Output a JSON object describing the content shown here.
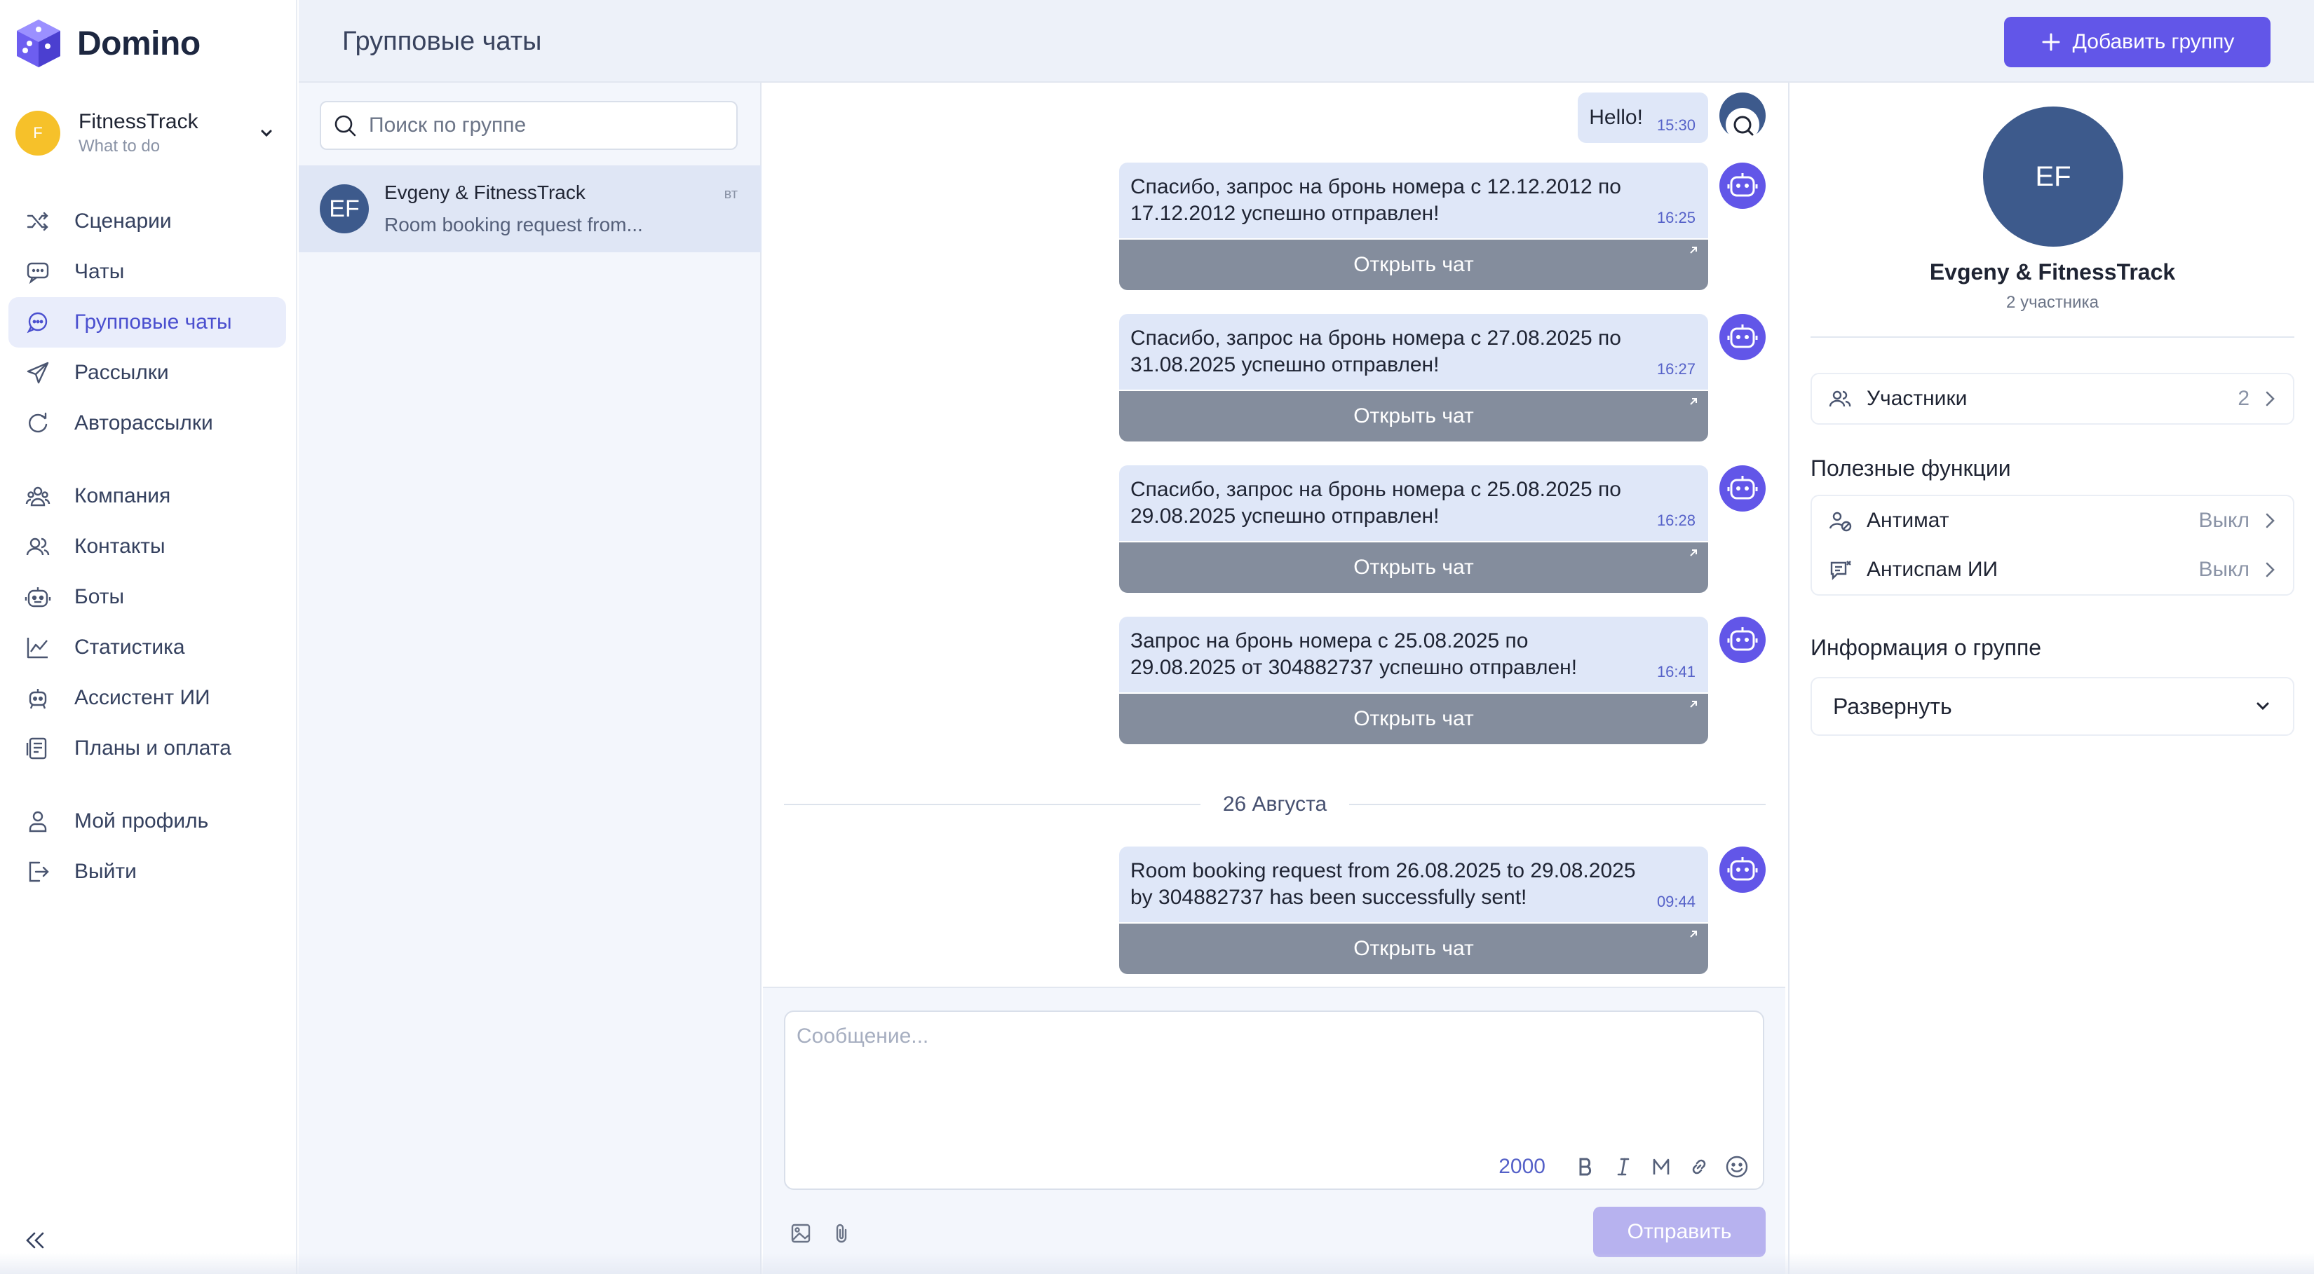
{
  "app": {
    "name": "Domino"
  },
  "company": {
    "initial": "F",
    "name": "FitnessTrack",
    "subtitle": "What to do"
  },
  "sidebar": {
    "items": [
      {
        "label": "Сценарии",
        "icon": "shuffle-icon"
      },
      {
        "label": "Чаты",
        "icon": "chat-bubble-icon"
      },
      {
        "label": "Групповые чаты",
        "icon": "group-chat-icon",
        "active": true
      },
      {
        "label": "Рассылки",
        "icon": "send-icon"
      },
      {
        "label": "Авторассылки",
        "icon": "auto-send-icon"
      },
      {
        "label": "Компания",
        "icon": "company-icon"
      },
      {
        "label": "Контакты",
        "icon": "contacts-icon"
      },
      {
        "label": "Боты",
        "icon": "bot-icon"
      },
      {
        "label": "Статистика",
        "icon": "stats-icon"
      },
      {
        "label": "Ассистент ИИ",
        "icon": "ai-assistant-icon"
      },
      {
        "label": "Планы и оплата",
        "icon": "billing-icon"
      },
      {
        "label": "Мой профиль",
        "icon": "profile-icon"
      },
      {
        "label": "Выйти",
        "icon": "logout-icon"
      }
    ]
  },
  "header": {
    "title": "Групповые чаты",
    "add_button": "Добавить группу"
  },
  "search": {
    "placeholder": "Поиск по группе"
  },
  "chat_list": [
    {
      "initials": "EF",
      "name": "Evgeny & FitnessTrack",
      "preview": "Room booking request from...",
      "day": "вт"
    }
  ],
  "messages": {
    "hello": {
      "text": "Hello!",
      "time": "15:30"
    },
    "bot_messages": [
      {
        "line1": "Спасибо, запрос на бронь номера с  12.12.2012 по",
        "line2": "17.12.2012 успешно отправлен!",
        "time": "16:25",
        "button": "Открыть чат"
      },
      {
        "line1": "Спасибо, запрос на бронь номера с  27.08.2025 по",
        "line2": "31.08.2025 успешно отправлен!",
        "time": "16:27",
        "button": "Открыть чат"
      },
      {
        "line1": "Спасибо, запрос на бронь номера с  25.08.2025 по",
        "line2": "29.08.2025 успешно отправлен!",
        "time": "16:28",
        "button": "Открыть чат"
      },
      {
        "line1": "Запрос на бронь номера с  25.08.2025 по",
        "line2": "29.08.2025 от 304882737 успешно отправлен!",
        "time": "16:41",
        "button": "Открыть чат"
      }
    ],
    "date_separator": "26 Августа",
    "last_message": {
      "line1": "Room booking request from 26.08.2025 to 29.08.2025",
      "line2": "by 304882737 has been successfully sent!",
      "time": "09:44",
      "button": "Открыть чат"
    }
  },
  "composer": {
    "placeholder": "Сообщение...",
    "char_limit": "2000",
    "send_label": "Отправить"
  },
  "group_info": {
    "initials": "EF",
    "name": "Evgeny & FitnessTrack",
    "members_count": "2 участника",
    "participants_label": "Участники",
    "participants_value": "2",
    "features_title": "Полезные функции",
    "features": [
      {
        "label": "Антимат",
        "value": "Выкл"
      },
      {
        "label": "Антиспам ИИ",
        "value": "Выкл"
      }
    ],
    "info_title": "Информация о группе",
    "expand_label": "Развернуть"
  },
  "colors": {
    "accent": "#6256e8",
    "bubble": "#dfe7f8",
    "open_chat_button": "#848d9d",
    "avatar": "#3d5a8c"
  }
}
